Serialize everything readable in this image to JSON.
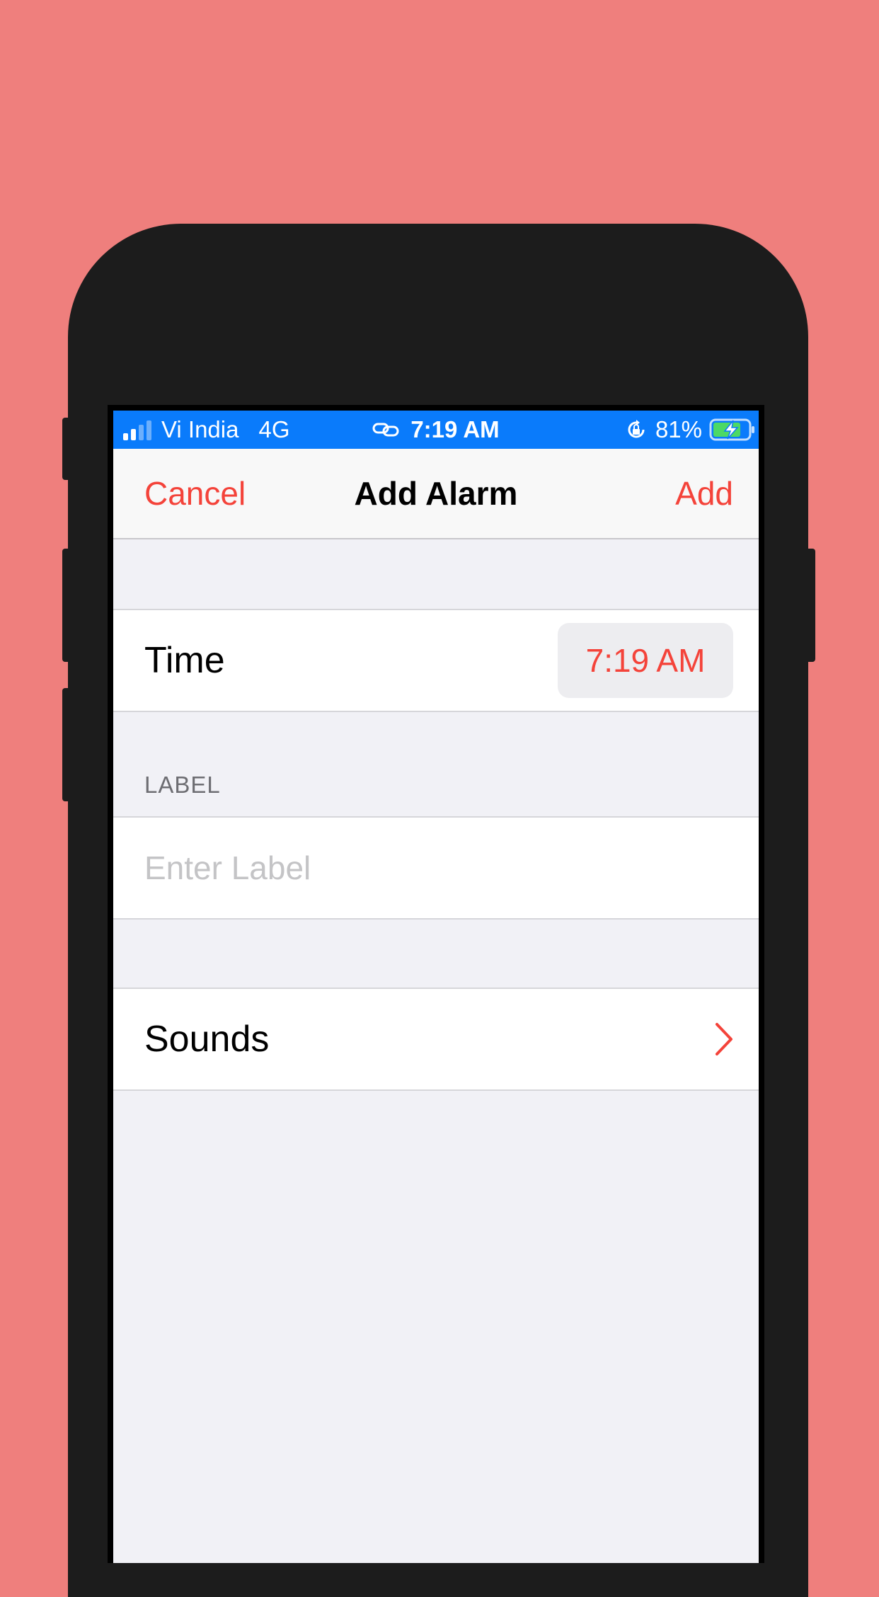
{
  "status_bar": {
    "carrier": "Vi India",
    "network": "4G",
    "time": "7:19 AM",
    "battery_percent": "81%",
    "signal_bars_active": 2,
    "signal_bars_total": 4,
    "background_color": "#0A7BFB"
  },
  "nav": {
    "cancel_label": "Cancel",
    "title": "Add Alarm",
    "add_label": "Add"
  },
  "time_row": {
    "label": "Time",
    "value": "7:19 AM"
  },
  "label_section": {
    "header": "LABEL",
    "placeholder": "Enter Label",
    "value": ""
  },
  "sounds_row": {
    "label": "Sounds",
    "icon": "chevron-right-icon"
  },
  "colors": {
    "accent": "#F4433A",
    "page_background": "#EF7F7D",
    "phone_frame": "#1C1C1C",
    "grouped_background": "#F1F1F6"
  }
}
